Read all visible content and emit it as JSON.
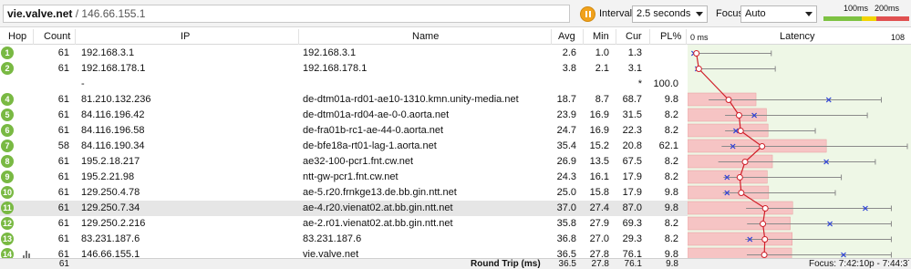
{
  "toolbar": {
    "target_host": "vie.valve.net",
    "target_sep": " / ",
    "target_ip": "146.66.155.1",
    "interval_label": "Interval",
    "interval_value": "2.5 seconds",
    "focus_label": "Focus",
    "focus_value": "Auto",
    "scale_100": "100ms",
    "scale_200": "200ms",
    "colors": {
      "green": "#7dc242",
      "yellow": "#f2d400",
      "red": "#e05050"
    }
  },
  "columns": {
    "hop": "Hop",
    "count": "Count",
    "ip": "IP",
    "name": "Name",
    "avg": "Avg",
    "min": "Min",
    "cur": "Cur",
    "pl": "PL%",
    "latency": "Latency",
    "lat_min": "0 ms",
    "lat_max": "108"
  },
  "rows": [
    {
      "hop": "1",
      "count": "61",
      "ip": "192.168.3.1",
      "name": "192.168.3.1",
      "avg": "2.6",
      "min": "1.0",
      "cur": "1.3",
      "pl": "",
      "avg_ms": 2.6,
      "min_ms": 1.0,
      "cur_ms": 1.3,
      "max_ms": 40,
      "pl_pct": 0
    },
    {
      "hop": "2",
      "count": "61",
      "ip": "192.168.178.1",
      "name": "192.168.178.1",
      "avg": "3.8",
      "min": "2.1",
      "cur": "3.1",
      "pl": "",
      "avg_ms": 3.8,
      "min_ms": 2.1,
      "cur_ms": 3.1,
      "max_ms": 42,
      "pl_pct": 0
    },
    {
      "hop": "",
      "count": "",
      "ip": "-",
      "name": "",
      "avg": "",
      "min": "",
      "cur": "*",
      "pl": "100.0",
      "pl_pct": 100,
      "no_reply": true
    },
    {
      "hop": "4",
      "count": "61",
      "ip": "81.210.132.236",
      "name": "de-dtm01a-rd01-ae10-1310.kmn.unity-media.net",
      "avg": "18.7",
      "min": "8.7",
      "cur": "68.7",
      "pl": "9.8",
      "avg_ms": 18.7,
      "min_ms": 8.7,
      "cur_ms": 68.7,
      "max_ms": 95,
      "pl_pct": 9.8
    },
    {
      "hop": "5",
      "count": "61",
      "ip": "84.116.196.42",
      "name": "de-dtm01a-rd04-ae-0-0.aorta.net",
      "avg": "23.9",
      "min": "16.9",
      "cur": "31.5",
      "pl": "8.2",
      "avg_ms": 23.9,
      "min_ms": 16.9,
      "cur_ms": 31.5,
      "max_ms": 88,
      "pl_pct": 8.2
    },
    {
      "hop": "6",
      "count": "61",
      "ip": "84.116.196.58",
      "name": "de-fra01b-rc1-ae-44-0.aorta.net",
      "avg": "24.7",
      "min": "16.9",
      "cur": "22.3",
      "pl": "8.2",
      "avg_ms": 24.7,
      "min_ms": 16.9,
      "cur_ms": 22.3,
      "max_ms": 62,
      "pl_pct": 8.2
    },
    {
      "hop": "7",
      "count": "58",
      "ip": "84.116.190.34",
      "name": "de-bfe18a-rt01-lag-1.aorta.net",
      "avg": "35.4",
      "min": "15.2",
      "cur": "20.8",
      "pl": "62.1",
      "avg_ms": 35.4,
      "min_ms": 15.2,
      "cur_ms": 20.8,
      "max_ms": 108,
      "pl_pct": 62.1
    },
    {
      "hop": "8",
      "count": "61",
      "ip": "195.2.18.217",
      "name": "ae32-100-pcr1.fnt.cw.net",
      "avg": "26.9",
      "min": "13.5",
      "cur": "67.5",
      "pl": "8.2",
      "avg_ms": 26.9,
      "min_ms": 13.5,
      "cur_ms": 67.5,
      "max_ms": 92,
      "pl_pct": 8.2
    },
    {
      "hop": "9",
      "count": "61",
      "ip": "195.2.21.98",
      "name": "ntt-gw-pcr1.fnt.cw.net",
      "avg": "24.3",
      "min": "16.1",
      "cur": "17.9",
      "pl": "8.2",
      "avg_ms": 24.3,
      "min_ms": 16.1,
      "cur_ms": 17.9,
      "max_ms": 75,
      "pl_pct": 8.2
    },
    {
      "hop": "10",
      "count": "61",
      "ip": "129.250.4.78",
      "name": "ae-5.r20.frnkge13.de.bb.gin.ntt.net",
      "avg": "25.0",
      "min": "15.8",
      "cur": "17.9",
      "pl": "9.8",
      "avg_ms": 25.0,
      "min_ms": 15.8,
      "cur_ms": 17.9,
      "max_ms": 72,
      "pl_pct": 9.8
    },
    {
      "hop": "11",
      "count": "61",
      "ip": "129.250.7.34",
      "name": "ae-4.r20.vienat02.at.bb.gin.ntt.net",
      "avg": "37.0",
      "min": "27.4",
      "cur": "87.0",
      "pl": "9.8",
      "avg_ms": 37.0,
      "min_ms": 27.4,
      "cur_ms": 87.0,
      "max_ms": 100,
      "pl_pct": 9.8,
      "selected": true
    },
    {
      "hop": "12",
      "count": "61",
      "ip": "129.250.2.216",
      "name": "ae-2.r01.vienat02.at.bb.gin.ntt.net",
      "avg": "35.8",
      "min": "27.9",
      "cur": "69.3",
      "pl": "8.2",
      "avg_ms": 35.8,
      "min_ms": 27.9,
      "cur_ms": 69.3,
      "max_ms": 100,
      "pl_pct": 8.2
    },
    {
      "hop": "13",
      "count": "61",
      "ip": "83.231.187.6",
      "name": "83.231.187.6",
      "avg": "36.8",
      "min": "27.0",
      "cur": "29.3",
      "pl": "8.2",
      "avg_ms": 36.8,
      "min_ms": 27.0,
      "cur_ms": 29.3,
      "max_ms": 100,
      "pl_pct": 8.2
    },
    {
      "hop": "14",
      "count": "61",
      "ip": "146.66.155.1",
      "name": "vie.valve.net",
      "avg": "36.5",
      "min": "27.8",
      "cur": "76.1",
      "pl": "9.8",
      "avg_ms": 36.5,
      "min_ms": 27.8,
      "cur_ms": 76.1,
      "max_ms": 100,
      "pl_pct": 9.8
    }
  ],
  "footer": {
    "count": "61",
    "label": "Round Trip (ms)",
    "avg": "36.5",
    "min": "27.8",
    "cur": "76.1",
    "pl": "9.8",
    "focus": "Focus: 7:42:10p - 7:44:37p"
  },
  "latency_scale_ms": 108
}
